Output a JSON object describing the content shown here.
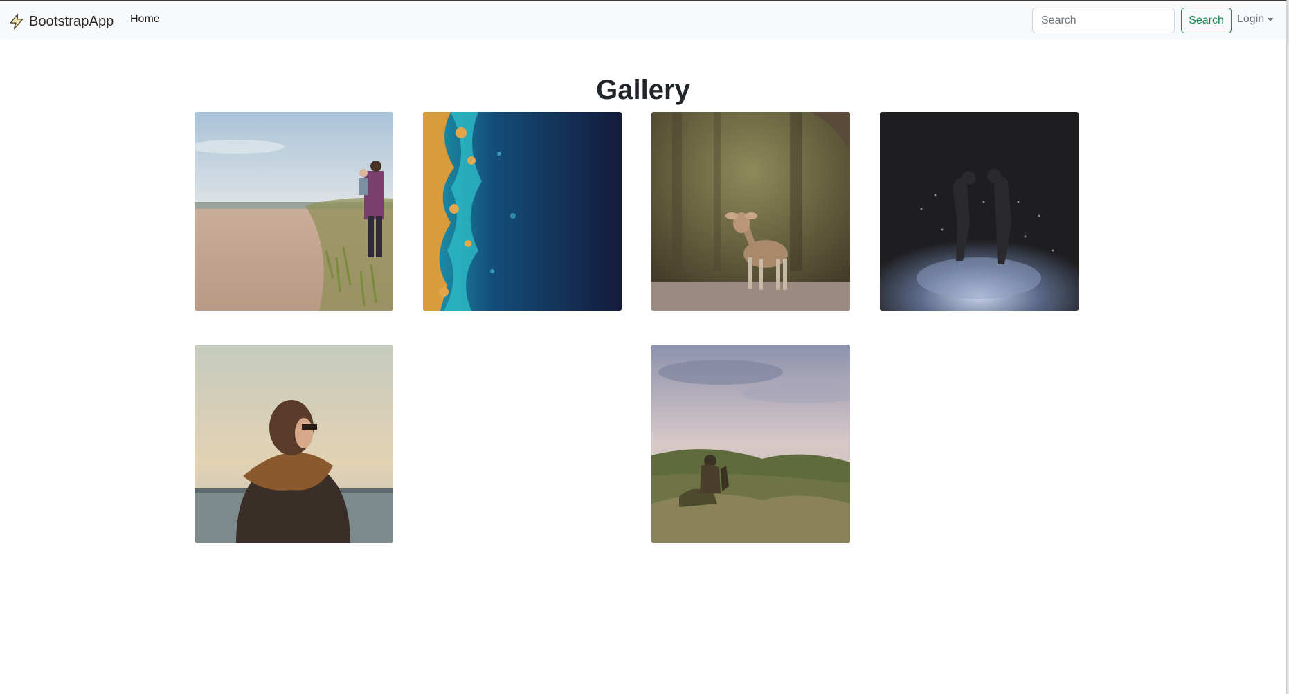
{
  "navbar": {
    "brand_icon": "lightning-icon",
    "brand_name": "BootstrapApp",
    "home_label": "Home",
    "search_placeholder": "Search",
    "search_button_label": "Search",
    "login_label": "Login",
    "accent_color": "#198754"
  },
  "main": {
    "title": "Gallery",
    "photos": [
      {
        "name": "photo-beach-father-child"
      },
      {
        "name": "photo-aerial-ocean-coast"
      },
      {
        "name": "photo-deer-forest"
      },
      {
        "name": "photo-couple-rain-night"
      },
      {
        "name": "photo-woman-scarf-sea"
      },
      {
        "name": "photo-person-cliff-fog"
      }
    ]
  }
}
